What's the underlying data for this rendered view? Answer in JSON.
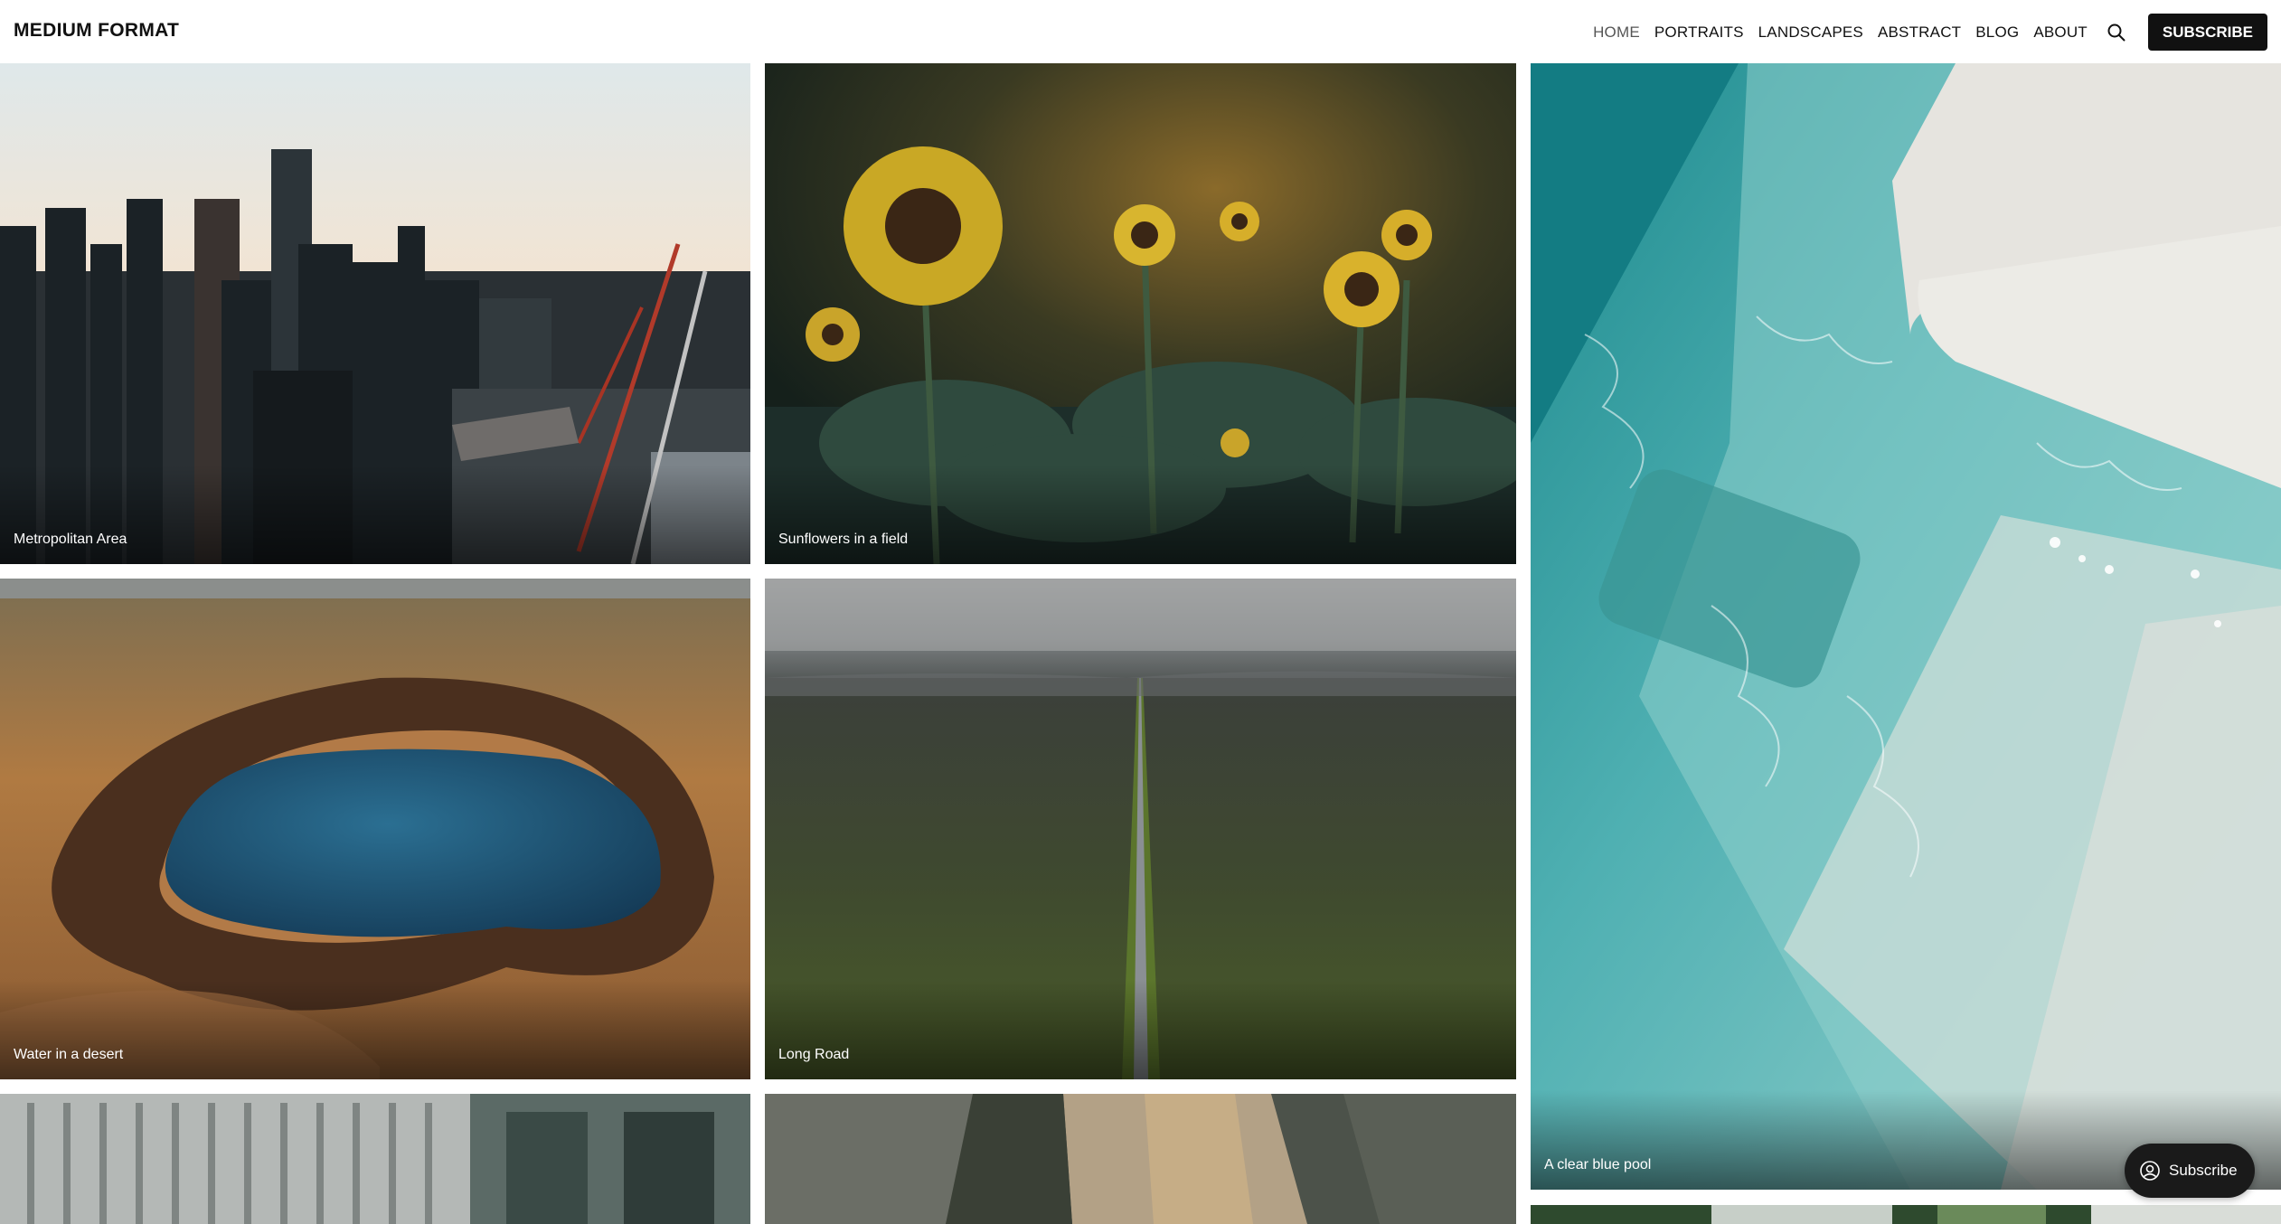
{
  "site": {
    "logo": "MEDIUM FORMAT"
  },
  "nav": {
    "items": [
      {
        "label": "HOME",
        "active": true
      },
      {
        "label": "PORTRAITS"
      },
      {
        "label": "LANDSCAPES"
      },
      {
        "label": "ABSTRACT"
      },
      {
        "label": "BLOG"
      },
      {
        "label": "ABOUT"
      }
    ],
    "search_icon": "search-icon",
    "subscribe_label": "SUBSCRIBE"
  },
  "gallery": [
    {
      "caption": "Metropolitan Area"
    },
    {
      "caption": "Sunflowers in a field"
    },
    {
      "caption": "A clear blue pool"
    },
    {
      "caption": "Water in a desert"
    },
    {
      "caption": "Long Road"
    }
  ],
  "floating_subscribe": {
    "label": "Subscribe",
    "icon": "user-circle-icon"
  },
  "colors": {
    "brand_dark": "#111111",
    "background": "#ffffff"
  }
}
